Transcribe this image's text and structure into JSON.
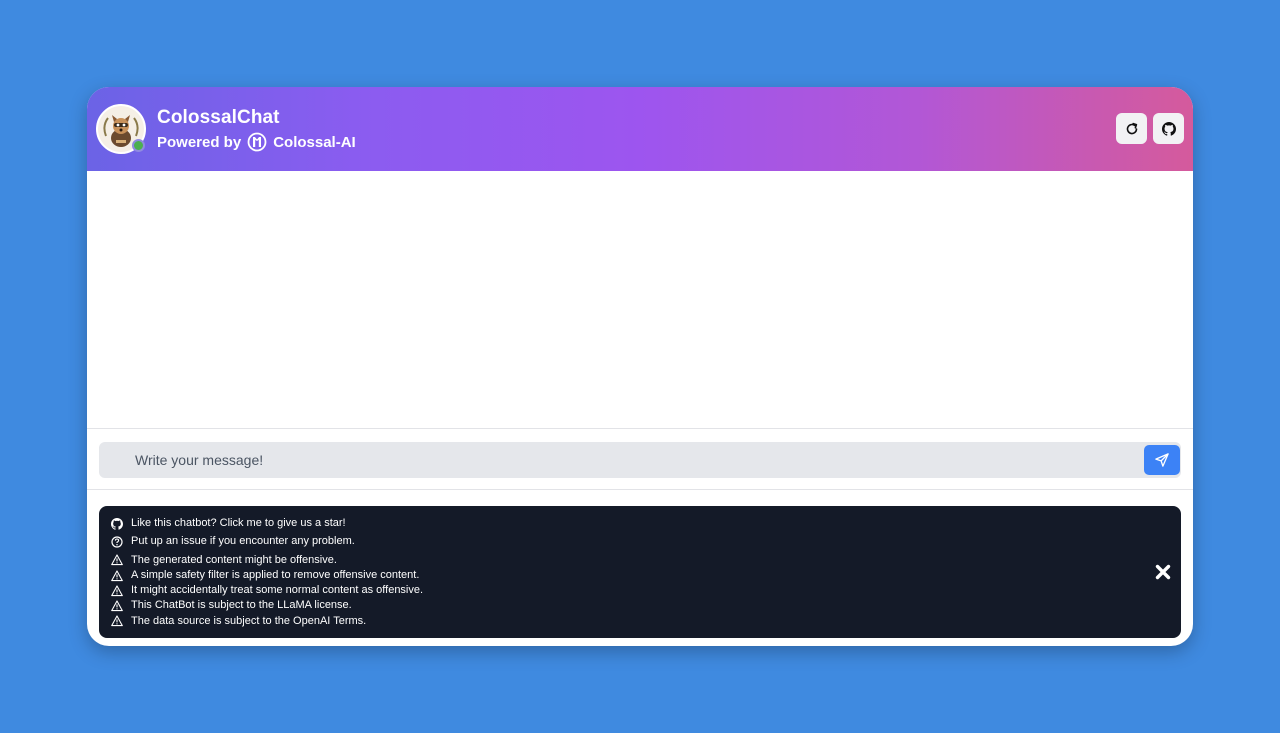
{
  "header": {
    "title": "ColossalChat",
    "powered_by": "Powered by",
    "brand": "Colossal-AI"
  },
  "composer": {
    "placeholder": "Write your message!"
  },
  "notices": {
    "star": "Like this chatbot? Click me to give us a star!",
    "issue": "Put up an issue if you encounter any problem.",
    "warnings": [
      "The generated content might be offensive.",
      "A simple safety filter is applied to remove offensive content.",
      "It might accidentally treat some normal content as offensive.",
      "This ChatBot is subject to the LLaMA license.",
      "The data source is subject to the OpenAI Terms."
    ]
  },
  "icons": {
    "refresh": "refresh-icon",
    "github": "github-icon",
    "send": "send-icon",
    "help": "question-circle-icon",
    "warning": "warning-triangle-icon",
    "close": "close-icon"
  },
  "colors": {
    "background": "#3f8ae0",
    "header_gradient_start": "#6b63e6",
    "header_gradient_end": "#d55a9c",
    "send_button": "#3c82f6",
    "notice_bg": "#141a28",
    "online": "#4caf50"
  }
}
